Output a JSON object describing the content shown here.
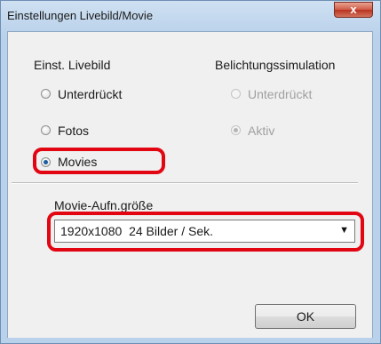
{
  "window": {
    "title": "Einstellungen Livebild/Movie",
    "close_label": "x"
  },
  "live_view": {
    "heading": "Einst. Livebild",
    "options": [
      {
        "label": "Unterdrückt",
        "selected": false
      },
      {
        "label": "Fotos",
        "selected": false
      },
      {
        "label": "Movies",
        "selected": true
      }
    ]
  },
  "exposure_sim": {
    "heading": "Belichtungssimulation",
    "enabled": false,
    "options": [
      {
        "label": "Unterdrückt",
        "selected": false
      },
      {
        "label": "Aktiv",
        "selected": true
      }
    ]
  },
  "movie_size": {
    "label": "Movie-Aufn.größe",
    "selected": "1920x1080  24 Bilder / Sek."
  },
  "ok_label": "OK",
  "colors": {
    "highlight": "#e20613",
    "title_bar": "#b9d1ea",
    "close_button": "#c8432f"
  }
}
